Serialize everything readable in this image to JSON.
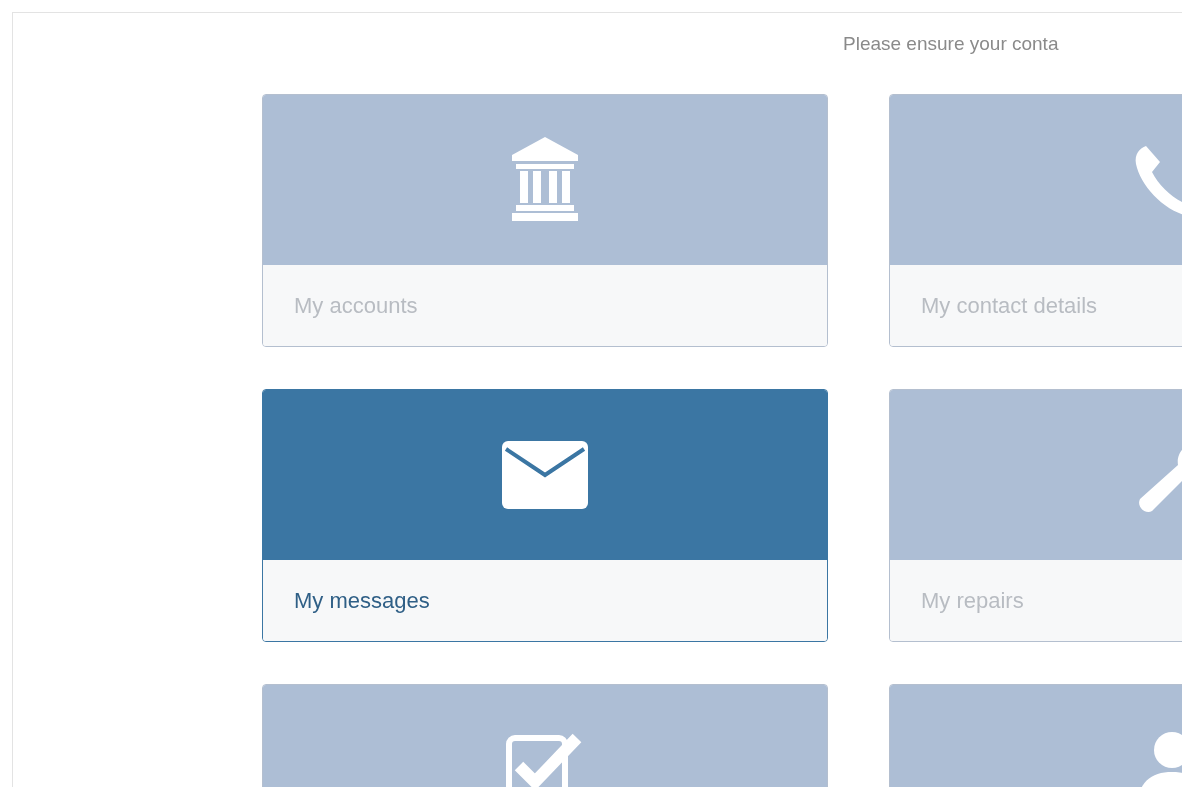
{
  "notice": "Please ensure your conta",
  "tiles": [
    {
      "kind": "bank",
      "label": "My accounts",
      "selected": false
    },
    {
      "kind": "phone",
      "label": "My contact details",
      "selected": false
    },
    {
      "kind": "envelope",
      "label": "My messages",
      "selected": true
    },
    {
      "kind": "wrench",
      "label": "My repairs",
      "selected": false
    },
    {
      "kind": "checkbox",
      "selected": false
    },
    {
      "kind": "person",
      "selected": false
    }
  ]
}
